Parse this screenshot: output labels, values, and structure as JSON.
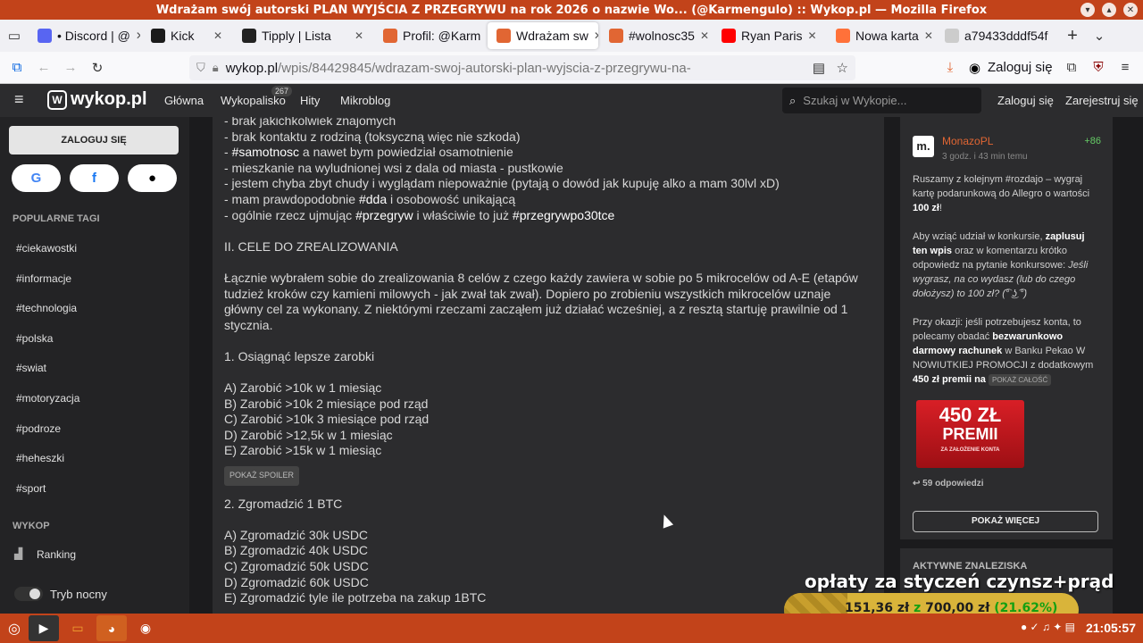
{
  "window": {
    "title": "Wdrażam swój autorski PLAN WYJŚCIA Z PRZEGRYWU na rok 2026 o nazwie Wo... (@Karmengulo) :: Wykop.pl — Mozilla Firefox"
  },
  "tabs": [
    {
      "label": "• Discord | @",
      "icon": "discord-icon",
      "color": "#5865f2"
    },
    {
      "label": "Kick",
      "icon": "kick-icon",
      "color": "#1b1b1b"
    },
    {
      "label": "Tipply | Lista",
      "icon": "tipply-icon",
      "color": "#222222"
    },
    {
      "label": "Profil: @Karm",
      "icon": "wykop-icon",
      "color": "#e16633"
    },
    {
      "label": "Wdrażam sw",
      "icon": "wykop-icon",
      "color": "#e16633",
      "active": true
    },
    {
      "label": "#wolnosc35",
      "icon": "wykop-icon",
      "color": "#e16633"
    },
    {
      "label": "Ryan Paris",
      "icon": "youtube-icon",
      "color": "#ff0000"
    },
    {
      "label": "Nowa karta",
      "icon": "firefox-icon",
      "color": "#ff7139"
    },
    {
      "label": "a79433dddf54f",
      "icon": "",
      "color": "#cccccc"
    }
  ],
  "url": {
    "domain": "wykop.pl",
    "path": "/wpis/84429845/wdrazam-swoj-autorski-plan-wyjscia-z-przegrywu-na-"
  },
  "browser": {
    "login_label": "Zaloguj się"
  },
  "header": {
    "logo": "wykop.pl",
    "menu": [
      "Główna",
      "Wykopalisko",
      "Hity",
      "Mikroblog"
    ],
    "badge": "267",
    "search_placeholder": "Szukaj w Wykopie...",
    "login": "Zaloguj się",
    "register": "Zarejestruj się"
  },
  "sidebar": {
    "login_button": "ZALOGUJ SIĘ",
    "popular_title": "POPULARNE TAGI",
    "tags": [
      "#ciekawostki",
      "#informacje",
      "#technologia",
      "#polska",
      "#swiat",
      "#motoryzacja",
      "#podroze",
      "#heheszki",
      "#sport"
    ],
    "wykop_title": "WYKOP",
    "ranking": "Ranking",
    "night_mode": "Tryb nocny"
  },
  "post": {
    "lines1": [
      "- brak jakichkolwiek znajomych",
      "- brak kontaktu z rodziną (toksyczną więc nie szkoda)"
    ],
    "line_samotnosc": {
      "pre": "- ",
      "tag": "#samotnosc",
      "post": " a nawet bym powiedział osamotnienie"
    },
    "lines2": [
      "- mieszkanie na wyludnionej wsi z dala od miasta - pustkowie",
      "- jestem chyba zbyt chudy i wyglądam niepoważnie (pytają o dowód jak kupuję alko a mam 30lvl xD)"
    ],
    "line_dda": {
      "pre": "- mam prawdopodobnie ",
      "tag": "#dda",
      "post": " i osobowość unikającą"
    },
    "line_przegryw": {
      "pre": "- ogólnie rzecz ujmując ",
      "tag1": "#przegryw",
      "mid": " i właściwie to już ",
      "tag2": "#przegrywpo30tce"
    },
    "section2": "II. CELE DO ZREALIZOWANIA",
    "intro": "Łącznie wybrałem sobie do zrealizowania 8 celów z czego każdy zawiera w sobie po 5 mikrocelów od A-E (etapów tudzież kroków czy kamieni milowych - jak zwał tak zwał). Dopiero po zrobieniu wszystkich mikrocelów uznaje główny cel za wykonany. Z niektórymi rzeczami zacząłem już działać wcześniej, a z resztą startuję prawilnie od 1 stycznia.",
    "goal1": "1. Osiągnąć lepsze zarobki",
    "goal1_items": [
      "A) Zarobić >10k w 1 miesiąc",
      "B) Zarobić >10k 2 miesiące pod rząd",
      "C) Zarobić >10k 3 miesiące pod rząd",
      "D) Zarobić >12,5k w 1 miesiąc",
      "E) Zarobić >15k w 1 miesiąc"
    ],
    "spoiler": "POKAŻ SPOILER",
    "goal2": "2. Zgromadzić 1 BTC",
    "goal2_items": [
      "A) Zgromadzić 30k USDC",
      "B) Zgromadzić 40k USDC",
      "C) Zgromadzić 50k USDC",
      "D) Zgromadzić 60k USDC",
      "E) Zgromadzić tyle ile potrzeba na zakup 1BTC"
    ]
  },
  "ad": {
    "avatar": "m.",
    "username": "MonazoPL",
    "time": "3 godz. i 43 min temu",
    "score": "+86",
    "p1_pre": "Ruszamy z kolejnym #rozdajo – wygraj kartę podarunkową do Allegro o wartości ",
    "p1_bold": "100 zł",
    "p1_post": "!",
    "p2_pre": "Aby wziąć udział w konkursie, ",
    "p2_bold": "zaplusuj ten wpis",
    "p2_mid": " oraz w komentarzu krótko odpowiedz na pytanie konkursowe: ",
    "p2_italic": "Jeśli wygrasz, na co wydasz (lub do czego dołożysz) to 100 zł? (͡° ͜ʖ ͡°)",
    "p3_pre": "Przy okazji: jeśli potrzebujesz konta, to polecamy obadać ",
    "p3_bold1": "bezwarunkowo darmowy rachunek",
    "p3_mid": " w Banku Pekao W NOWIUTKIEJ PROMOCJI z dodatkowym ",
    "p3_bold2": "450 zł premii na",
    "show_all": "POKAŻ CAŁOŚĆ",
    "promo_big": "450 ZŁ",
    "promo_mid": "PREMII",
    "promo_small": "ZA ZAŁOŻENIE KONTA",
    "replies": "59 odpowiedzi",
    "more": "POKAŻ WIĘCEJ",
    "active_title": "AKTYWNE ZNALEZISKA"
  },
  "overlay": {
    "title": "opłaty za styczeń czynsz+prąd",
    "amount": "151,36 zł",
    "sep": "z",
    "goal": "700,00 zł",
    "percent_label": "(21.62%)",
    "progress_percent": 21.62
  },
  "taskbar": {
    "clock": "21:05:57"
  }
}
